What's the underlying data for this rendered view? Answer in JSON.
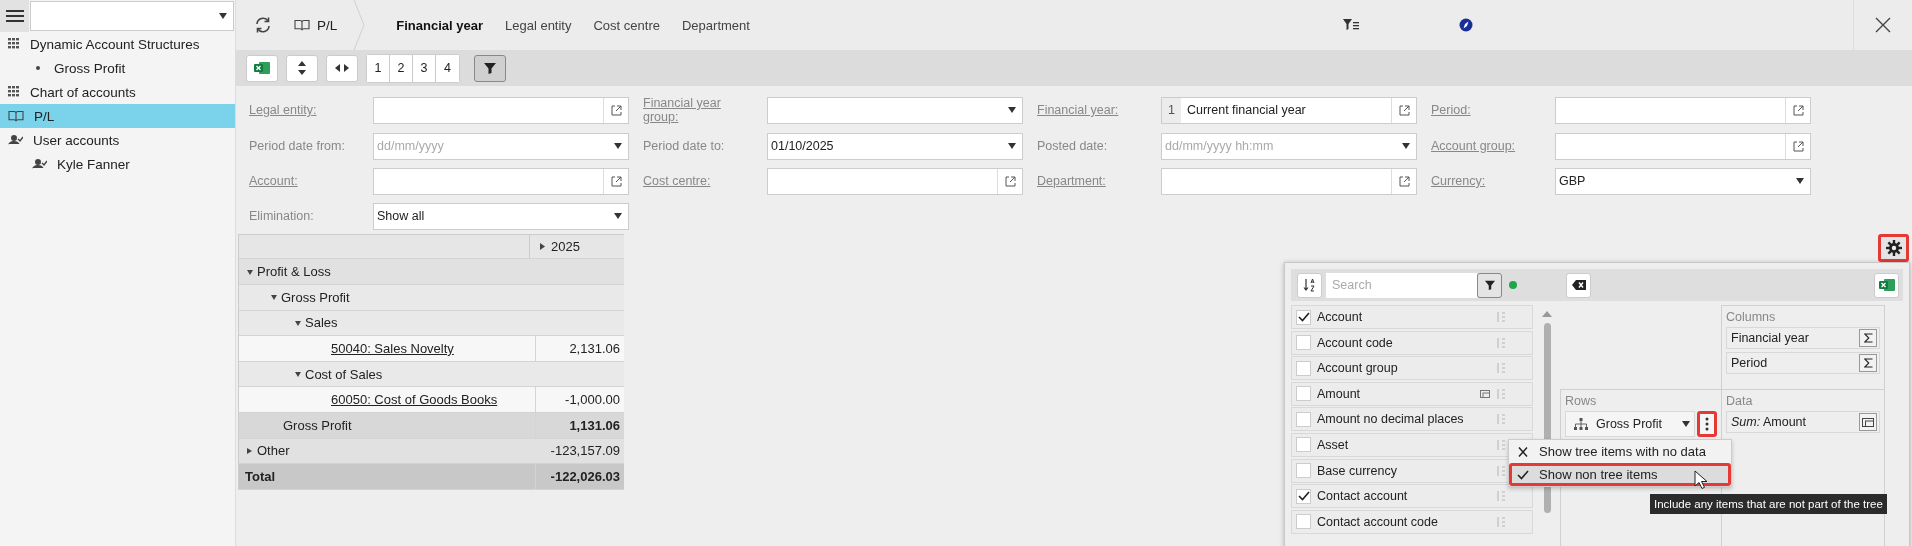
{
  "sidebar": {
    "items": [
      {
        "label": "Dynamic Account Structures",
        "kind": "structure",
        "selected": false,
        "children": [
          {
            "label": "Gross Profit",
            "kind": "entry",
            "selected": false
          }
        ]
      },
      {
        "label": "Chart of accounts",
        "kind": "structure",
        "selected": false
      },
      {
        "label": "P/L",
        "kind": "report",
        "selected": true
      },
      {
        "label": "User accounts",
        "kind": "people",
        "selected": false,
        "children": [
          {
            "label": "Kyle Fanner",
            "kind": "people",
            "selected": false
          }
        ]
      }
    ]
  },
  "breadcrumb": {
    "label": "P/L"
  },
  "tabs": [
    {
      "label": "Financial year",
      "selected": true
    },
    {
      "label": "Legal entity",
      "selected": false
    },
    {
      "label": "Cost centre",
      "selected": false
    },
    {
      "label": "Department",
      "selected": false
    }
  ],
  "toolbar": {
    "levels": [
      "1",
      "2",
      "3",
      "4"
    ],
    "filter_pressed": true
  },
  "filters": [
    {
      "label": "Legal entity:",
      "kind": "lookup",
      "linked": true
    },
    {
      "label": "Financial year group:",
      "kind": "dropdown",
      "linked": true
    },
    {
      "label": "Financial year:",
      "kind": "lookup",
      "linked": true,
      "prefix": "1",
      "value": "Current financial year"
    },
    {
      "label": "Period:",
      "kind": "lookup",
      "linked": true
    },
    {
      "label": "Period date from:",
      "kind": "dropdown",
      "linked": false,
      "placeholder": "dd/mm/yyyy"
    },
    {
      "label": "Period date to:",
      "kind": "dropdown",
      "linked": false,
      "value": "01/10/2025"
    },
    {
      "label": "Posted date:",
      "kind": "dropdown",
      "linked": false,
      "placeholder": "dd/mm/yyyy hh:mm"
    },
    {
      "label": "Account group:",
      "kind": "lookup",
      "linked": true
    },
    {
      "label": "Account:",
      "kind": "lookup",
      "linked": true
    },
    {
      "label": "Cost centre:",
      "kind": "lookup",
      "linked": true
    },
    {
      "label": "Department:",
      "kind": "lookup",
      "linked": true
    },
    {
      "label": "Currency:",
      "kind": "dropdown",
      "linked": true,
      "value": "GBP"
    },
    {
      "label": "Elimination:",
      "kind": "dropdown",
      "linked": false,
      "value": "Show all"
    }
  ],
  "table": {
    "columns": [
      {
        "label": "2025",
        "expanded": false
      }
    ],
    "rows": [
      {
        "label": "Profit & Loss",
        "kind": "group",
        "expanded": true,
        "children": [
          {
            "label": "Gross Profit",
            "kind": "group",
            "expanded": true,
            "children": [
              {
                "label": "Sales",
                "kind": "group",
                "expanded": true,
                "children": [
                  {
                    "label": "50040: Sales Novelty",
                    "kind": "account",
                    "value": "2,131.06"
                  }
                ]
              },
              {
                "label": "Cost of Sales",
                "kind": "group",
                "expanded": true,
                "children": [
                  {
                    "label": "60050: Cost of Goods Books",
                    "kind": "account",
                    "value": "-1,000.00"
                  }
                ]
              }
            ]
          },
          {
            "label": "Gross Profit",
            "kind": "subtotal",
            "value": "1,131.06"
          }
        ]
      },
      {
        "label": "Other",
        "kind": "group",
        "expanded": false,
        "value": "-123,157.09"
      },
      {
        "label": "Total",
        "kind": "total",
        "value": "-122,026.03"
      }
    ]
  },
  "settings_button": {
    "highlighted": true
  },
  "pivot": {
    "search": {
      "placeholder": "Search"
    },
    "fields": [
      {
        "label": "Account",
        "checked": true
      },
      {
        "label": "Account code",
        "checked": false
      },
      {
        "label": "Account group",
        "checked": false
      },
      {
        "label": "Amount",
        "checked": false,
        "measure": true
      },
      {
        "label": "Amount no decimal places",
        "checked": false
      },
      {
        "label": "Asset",
        "checked": false
      },
      {
        "label": "Base currency",
        "checked": false
      },
      {
        "label": "Contact account",
        "checked": true
      },
      {
        "label": "Contact account code",
        "checked": false
      }
    ],
    "columns_area": {
      "title": "Columns",
      "items": [
        "Financial year",
        "Period"
      ]
    },
    "rows_area": {
      "title": "Rows",
      "items": [
        {
          "label": "Gross Profit",
          "menu_highlighted": true
        }
      ]
    },
    "data_area": {
      "title": "Data",
      "items": [
        "*Sum:* Amount"
      ]
    }
  },
  "menu": [
    {
      "label": "Show tree items with no data",
      "checked": false,
      "highlighted": false
    },
    {
      "label": "Show non tree items",
      "checked": true,
      "highlighted": true
    }
  ],
  "tooltip": {
    "text": "Include any items that are not part of the tree"
  }
}
